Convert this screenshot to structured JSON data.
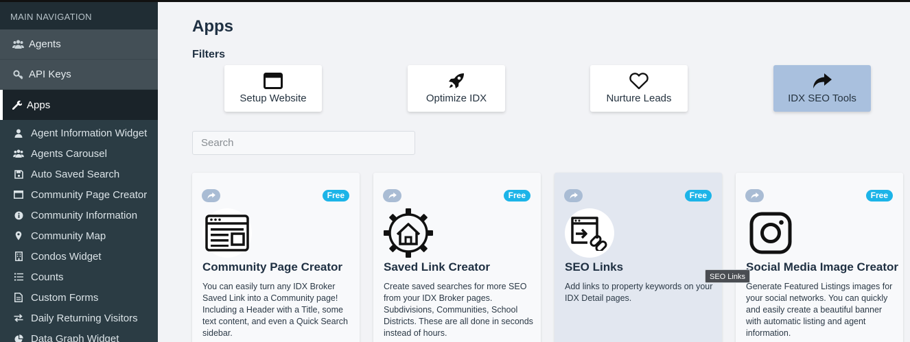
{
  "sidebar": {
    "header": "MAIN NAVIGATION",
    "top_items": [
      {
        "label": "Agents",
        "icon": "users-icon"
      },
      {
        "label": "API Keys",
        "icon": "key-icon"
      }
    ],
    "active_item": {
      "label": "Apps",
      "icon": "wrench-icon"
    },
    "sub_items": [
      {
        "label": "Agent Information Widget",
        "icon": "user-icon"
      },
      {
        "label": "Agents Carousel",
        "icon": "users-icon"
      },
      {
        "label": "Auto Saved Search",
        "icon": "save-icon"
      },
      {
        "label": "Community Page Creator",
        "icon": "window-icon"
      },
      {
        "label": "Community Information",
        "icon": "info-icon"
      },
      {
        "label": "Community Map",
        "icon": "map-marker-icon"
      },
      {
        "label": "Condos Widget",
        "icon": "building-icon"
      },
      {
        "label": "Counts",
        "icon": "list-icon"
      },
      {
        "label": "Custom Forms",
        "icon": "form-icon"
      },
      {
        "label": "Daily Returning Visitors",
        "icon": "exchange-icon"
      },
      {
        "label": "Data Graph Widget",
        "icon": "pie-chart-icon"
      }
    ]
  },
  "main": {
    "title": "Apps",
    "filters_label": "Filters",
    "filters": [
      {
        "label": "Setup Website",
        "icon": "window-icon",
        "selected": false
      },
      {
        "label": "Optimize IDX",
        "icon": "rocket-icon",
        "selected": false
      },
      {
        "label": "Nurture Leads",
        "icon": "heart-icon",
        "selected": false
      },
      {
        "label": "IDX SEO Tools",
        "icon": "share-icon",
        "selected": true
      }
    ],
    "search": {
      "placeholder": "Search",
      "value": ""
    },
    "cards": [
      {
        "title": "Community Page Creator",
        "badge": "Free",
        "icon": "browser-window-icon",
        "description": "You can easily turn any IDX Broker Saved Link into a Community page! Including a Header with a Title, some text content, and even a Quick Search sidebar."
      },
      {
        "title": "Saved Link Creator",
        "badge": "Free",
        "icon": "gear-house-icon",
        "description": "Create saved searches for more SEO from your IDX Broker pages. Subdivisions, Communities, School Districts. These are all done in seconds instead of hours."
      },
      {
        "title": "SEO Links",
        "badge": "Free",
        "icon": "link-window-icon",
        "description": "Add links to property keywords on your IDX Detail pages."
      },
      {
        "title": "Social Media Image Creator",
        "badge": "Free",
        "icon": "instagram-icon",
        "description": "Generate Featured Listings images for your social networks. You can quickly and easily create a beautiful banner with automatic listing and agent information."
      }
    ],
    "tooltip": "SEO Links"
  },
  "colors": {
    "sidebar_bg": "#2b3c44",
    "badge": "#1cb4e8",
    "selected_filter": "#a9c0de"
  }
}
